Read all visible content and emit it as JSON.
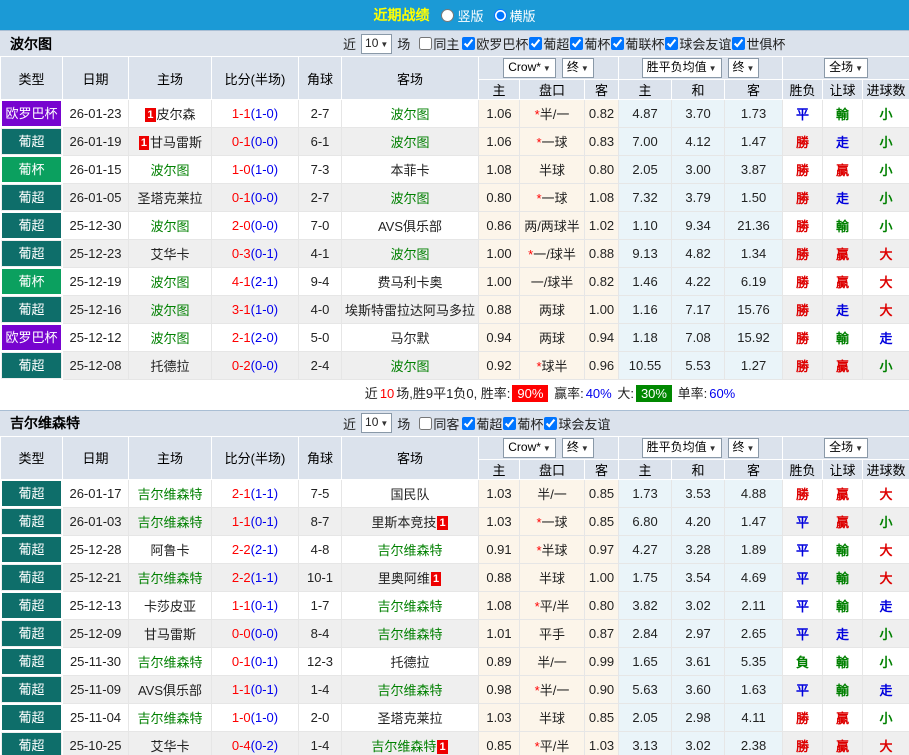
{
  "header": {
    "title": "近期战绩",
    "radios": [
      {
        "label": "竖版",
        "checked": false
      },
      {
        "label": "横版",
        "checked": true
      }
    ]
  },
  "columns": {
    "type": "类型",
    "date": "日期",
    "home": "主场",
    "score": "比分(半场)",
    "corner": "角球",
    "away": "客场"
  },
  "odds_header": {
    "crow": "Crow*",
    "final1": "终",
    "avg": "胜平负均值",
    "final2": "终",
    "full": "全场",
    "sub": [
      "主",
      "盘口",
      "客",
      "主",
      "和",
      "客",
      "胜负",
      "让球",
      "进球数"
    ]
  },
  "league_colors": {
    "欧罗巴杯": "#7704cf",
    "葡超": "#0e6e6a",
    "葡杯": "#0ba05f"
  },
  "result_colors": {
    "勝": "red",
    "贏": "red",
    "大": "red",
    "平": "blue",
    "走": "blue",
    "負": "green",
    "輸": "green",
    "小": "green"
  },
  "sections": [
    {
      "team": "波尔图",
      "filter": {
        "near": "近",
        "count": "10",
        "games": "场",
        "same": "同主",
        "same_checked": false,
        "leagues": [
          "欧罗巴杯",
          "葡超",
          "葡杯",
          "葡联杯",
          "球会友谊",
          "世俱杯"
        ]
      },
      "rows": [
        {
          "league": "欧罗巴杯",
          "date": "26-01-23",
          "home": {
            "name": "皮尔森",
            "badge": "1",
            "badge_before": true
          },
          "score": "1-1",
          "half": "(1-0)",
          "corner": "2-7",
          "away": {
            "name": "波尔图",
            "team": true
          },
          "o1": "1.06",
          "pk": "*半/一",
          "o2": "0.82",
          "e1": "4.87",
          "e2": "3.70",
          "e3": "1.73",
          "r1": "平",
          "r2": "輸",
          "r3": "小"
        },
        {
          "league": "葡超",
          "date": "26-01-19",
          "home": {
            "name": "甘马雷斯",
            "badge": "1",
            "badge_before": true
          },
          "score": "0-1",
          "half": "(0-0)",
          "corner": "6-1",
          "away": {
            "name": "波尔图",
            "team": true
          },
          "o1": "1.06",
          "pk": "*一球",
          "o2": "0.83",
          "e1": "7.00",
          "e2": "4.12",
          "e3": "1.47",
          "r1": "勝",
          "r2": "走",
          "r3": "小"
        },
        {
          "league": "葡杯",
          "date": "26-01-15",
          "home": {
            "name": "波尔图",
            "team": true
          },
          "score": "1-0",
          "half": "(1-0)",
          "corner": "7-3",
          "away": {
            "name": "本菲卡"
          },
          "o1": "1.08",
          "pk": "半球",
          "o2": "0.80",
          "e1": "2.05",
          "e2": "3.00",
          "e3": "3.87",
          "r1": "勝",
          "r2": "贏",
          "r3": "小"
        },
        {
          "league": "葡超",
          "date": "26-01-05",
          "home": {
            "name": "圣塔克莱拉"
          },
          "score": "0-1",
          "half": "(0-0)",
          "corner": "2-7",
          "away": {
            "name": "波尔图",
            "team": true
          },
          "o1": "0.80",
          "pk": "*一球",
          "o2": "1.08",
          "e1": "7.32",
          "e2": "3.79",
          "e3": "1.50",
          "r1": "勝",
          "r2": "走",
          "r3": "小"
        },
        {
          "league": "葡超",
          "date": "25-12-30",
          "home": {
            "name": "波尔图",
            "team": true
          },
          "score": "2-0",
          "half": "(0-0)",
          "corner": "7-0",
          "away": {
            "name": "AVS俱乐部"
          },
          "o1": "0.86",
          "pk": "两/两球半",
          "o2": "1.02",
          "e1": "1.10",
          "e2": "9.34",
          "e3": "21.36",
          "r1": "勝",
          "r2": "輸",
          "r3": "小"
        },
        {
          "league": "葡超",
          "date": "25-12-23",
          "home": {
            "name": "艾华卡"
          },
          "score": "0-3",
          "half": "(0-1)",
          "corner": "4-1",
          "away": {
            "name": "波尔图",
            "team": true
          },
          "o1": "1.00",
          "pk": "*一/球半",
          "o2": "0.88",
          "e1": "9.13",
          "e2": "4.82",
          "e3": "1.34",
          "r1": "勝",
          "r2": "贏",
          "r3": "大"
        },
        {
          "league": "葡杯",
          "date": "25-12-19",
          "home": {
            "name": "波尔图",
            "team": true
          },
          "score": "4-1",
          "half": "(2-1)",
          "corner": "9-4",
          "away": {
            "name": "费马利卡奥"
          },
          "o1": "1.00",
          "pk": "一/球半",
          "o2": "0.82",
          "e1": "1.46",
          "e2": "4.22",
          "e3": "6.19",
          "r1": "勝",
          "r2": "贏",
          "r3": "大"
        },
        {
          "league": "葡超",
          "date": "25-12-16",
          "home": {
            "name": "波尔图",
            "team": true
          },
          "score": "3-1",
          "half": "(1-0)",
          "corner": "4-0",
          "away": {
            "name": "埃斯特雷拉达阿马多拉"
          },
          "o1": "0.88",
          "pk": "两球",
          "o2": "1.00",
          "e1": "1.16",
          "e2": "7.17",
          "e3": "15.76",
          "r1": "勝",
          "r2": "走",
          "r3": "大"
        },
        {
          "league": "欧罗巴杯",
          "date": "25-12-12",
          "home": {
            "name": "波尔图",
            "team": true
          },
          "score": "2-1",
          "half": "(2-0)",
          "corner": "5-0",
          "away": {
            "name": "马尔默"
          },
          "o1": "0.94",
          "pk": "两球",
          "o2": "0.94",
          "e1": "1.18",
          "e2": "7.08",
          "e3": "15.92",
          "r1": "勝",
          "r2": "輸",
          "r3": "走"
        },
        {
          "league": "葡超",
          "date": "25-12-08",
          "home": {
            "name": "托德拉"
          },
          "score": "0-2",
          "half": "(0-0)",
          "corner": "2-4",
          "away": {
            "name": "波尔图",
            "team": true
          },
          "o1": "0.92",
          "pk": "*球半",
          "o2": "0.96",
          "e1": "10.55",
          "e2": "5.53",
          "e3": "1.27",
          "r1": "勝",
          "r2": "贏",
          "r3": "小"
        }
      ],
      "summary": [
        {
          "t": "近"
        },
        {
          "t": "10",
          "c": "red"
        },
        {
          "t": "场,胜9平1负0, 胜率:"
        },
        {
          "t": "90%",
          "bg": "red"
        },
        {
          "t": " 赢率:"
        },
        {
          "t": "40%",
          "c": "blue"
        },
        {
          "t": " 大:"
        },
        {
          "t": "30%",
          "bg": "green"
        },
        {
          "t": " 单率:"
        },
        {
          "t": "60%",
          "c": "blue"
        }
      ]
    },
    {
      "team": "吉尔维森特",
      "filter": {
        "near": "近",
        "count": "10",
        "games": "场",
        "same": "同客",
        "same_checked": false,
        "leagues": [
          "葡超",
          "葡杯",
          "球会友谊"
        ]
      },
      "rows": [
        {
          "league": "葡超",
          "date": "26-01-17",
          "home": {
            "name": "吉尔维森特",
            "team": true
          },
          "score": "2-1",
          "half": "(1-1)",
          "corner": "7-5",
          "away": {
            "name": "国民队"
          },
          "o1": "1.03",
          "pk": "半/一",
          "o2": "0.85",
          "e1": "1.73",
          "e2": "3.53",
          "e3": "4.88",
          "r1": "勝",
          "r2": "贏",
          "r3": "大"
        },
        {
          "league": "葡超",
          "date": "26-01-03",
          "home": {
            "name": "吉尔维森特",
            "team": true
          },
          "score": "1-1",
          "half": "(0-1)",
          "corner": "8-7",
          "away": {
            "name": "里斯本竞技",
            "badge": "1"
          },
          "o1": "1.03",
          "pk": "*一球",
          "o2": "0.85",
          "e1": "6.80",
          "e2": "4.20",
          "e3": "1.47",
          "r1": "平",
          "r2": "贏",
          "r3": "小"
        },
        {
          "league": "葡超",
          "date": "25-12-28",
          "home": {
            "name": "阿鲁卡"
          },
          "score": "2-2",
          "half": "(2-1)",
          "corner": "4-8",
          "away": {
            "name": "吉尔维森特",
            "team": true
          },
          "o1": "0.91",
          "pk": "*半球",
          "o2": "0.97",
          "e1": "4.27",
          "e2": "3.28",
          "e3": "1.89",
          "r1": "平",
          "r2": "輸",
          "r3": "大"
        },
        {
          "league": "葡超",
          "date": "25-12-21",
          "home": {
            "name": "吉尔维森特",
            "team": true
          },
          "score": "2-2",
          "half": "(1-1)",
          "corner": "10-1",
          "away": {
            "name": "里奥阿维",
            "badge": "1"
          },
          "o1": "0.88",
          "pk": "半球",
          "o2": "1.00",
          "e1": "1.75",
          "e2": "3.54",
          "e3": "4.69",
          "r1": "平",
          "r2": "輸",
          "r3": "大"
        },
        {
          "league": "葡超",
          "date": "25-12-13",
          "home": {
            "name": "卡莎皮亚"
          },
          "score": "1-1",
          "half": "(0-1)",
          "corner": "1-7",
          "away": {
            "name": "吉尔维森特",
            "team": true
          },
          "o1": "1.08",
          "pk": "*平/半",
          "o2": "0.80",
          "e1": "3.82",
          "e2": "3.02",
          "e3": "2.11",
          "r1": "平",
          "r2": "輸",
          "r3": "走"
        },
        {
          "league": "葡超",
          "date": "25-12-09",
          "home": {
            "name": "甘马雷斯"
          },
          "score": "0-0",
          "half": "(0-0)",
          "corner": "8-4",
          "away": {
            "name": "吉尔维森特",
            "team": true
          },
          "o1": "1.01",
          "pk": "平手",
          "o2": "0.87",
          "e1": "2.84",
          "e2": "2.97",
          "e3": "2.65",
          "r1": "平",
          "r2": "走",
          "r3": "小"
        },
        {
          "league": "葡超",
          "date": "25-11-30",
          "home": {
            "name": "吉尔维森特",
            "team": true
          },
          "score": "0-1",
          "half": "(0-1)",
          "corner": "12-3",
          "away": {
            "name": "托德拉"
          },
          "o1": "0.89",
          "pk": "半/一",
          "o2": "0.99",
          "e1": "1.65",
          "e2": "3.61",
          "e3": "5.35",
          "r1": "負",
          "r2": "輸",
          "r3": "小"
        },
        {
          "league": "葡超",
          "date": "25-11-09",
          "home": {
            "name": "AVS俱乐部"
          },
          "score": "1-1",
          "half": "(0-1)",
          "corner": "1-4",
          "away": {
            "name": "吉尔维森特",
            "team": true
          },
          "o1": "0.98",
          "pk": "*半/一",
          "o2": "0.90",
          "e1": "5.63",
          "e2": "3.60",
          "e3": "1.63",
          "r1": "平",
          "r2": "輸",
          "r3": "走"
        },
        {
          "league": "葡超",
          "date": "25-11-04",
          "home": {
            "name": "吉尔维森特",
            "team": true
          },
          "score": "1-0",
          "half": "(1-0)",
          "corner": "2-0",
          "away": {
            "name": "圣塔克莱拉"
          },
          "o1": "1.03",
          "pk": "半球",
          "o2": "0.85",
          "e1": "2.05",
          "e2": "2.98",
          "e3": "4.11",
          "r1": "勝",
          "r2": "贏",
          "r3": "小"
        },
        {
          "league": "葡超",
          "date": "25-10-25",
          "home": {
            "name": "艾华卡"
          },
          "score": "0-4",
          "half": "(0-2)",
          "corner": "1-4",
          "away": {
            "name": "吉尔维森特",
            "team": true,
            "badge": "1"
          },
          "o1": "0.85",
          "pk": "*平/半",
          "o2": "1.03",
          "e1": "3.13",
          "e2": "3.02",
          "e3": "2.38",
          "r1": "勝",
          "r2": "贏",
          "r3": "大"
        }
      ]
    }
  ]
}
